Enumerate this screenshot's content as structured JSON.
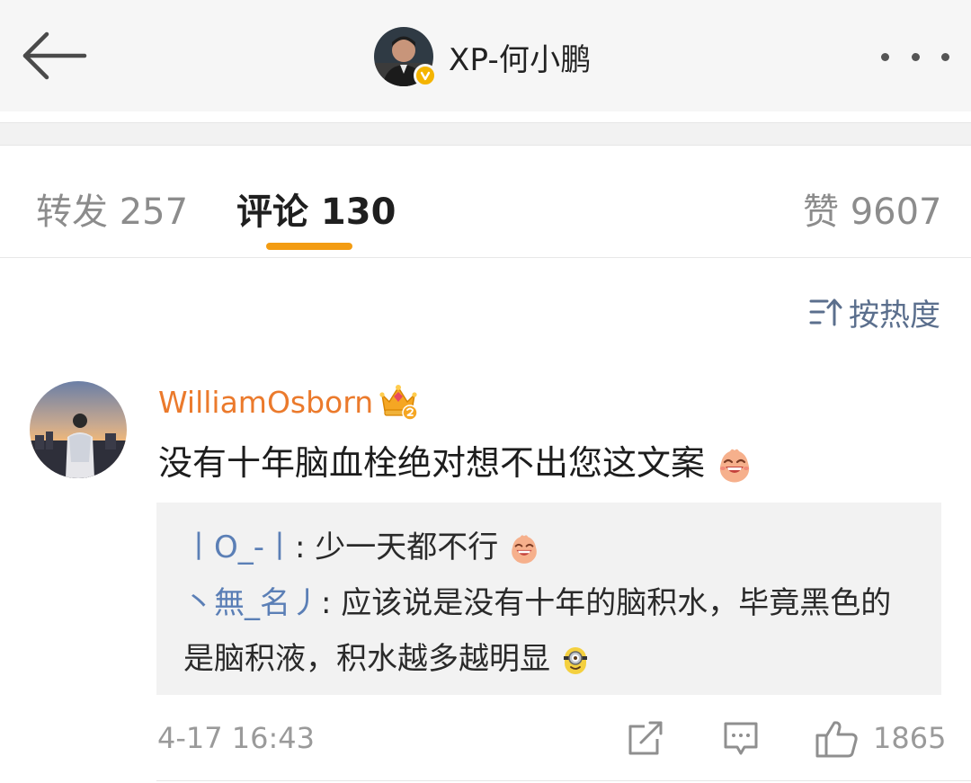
{
  "header": {
    "profile_name": "XP-何小鹏",
    "back_icon": "arrow-left-icon",
    "more_icon": "more-dots-icon",
    "verified_badge_color": "#f4b400"
  },
  "tabs": {
    "repost_label": "转发 257",
    "comments_label": "评论 130",
    "likes_label": "赞 9607",
    "active": "comments",
    "indicator_color": "#f39c12"
  },
  "sort": {
    "label": "按热度",
    "icon": "sort-icon"
  },
  "comment": {
    "username": "WilliamOsborn",
    "username_color": "#eb7a2c",
    "badge_icon": "crown-icon",
    "text": "没有十年脑血栓绝对想不出您这文案",
    "text_emoji": "laughing-face-icon",
    "time": "4-17 16:43",
    "like_count": "1865",
    "replies": [
      {
        "name": "丨O_-丨",
        "sep": ": ",
        "text": "少一天都不行",
        "emoji": "laughing-face-icon"
      },
      {
        "name": "丶無_名丿",
        "sep": ": ",
        "text": "应该说是没有十年的脑积水，毕竟黑色的是脑积液，积水越多越明显",
        "emoji": "minion-icon"
      }
    ]
  }
}
